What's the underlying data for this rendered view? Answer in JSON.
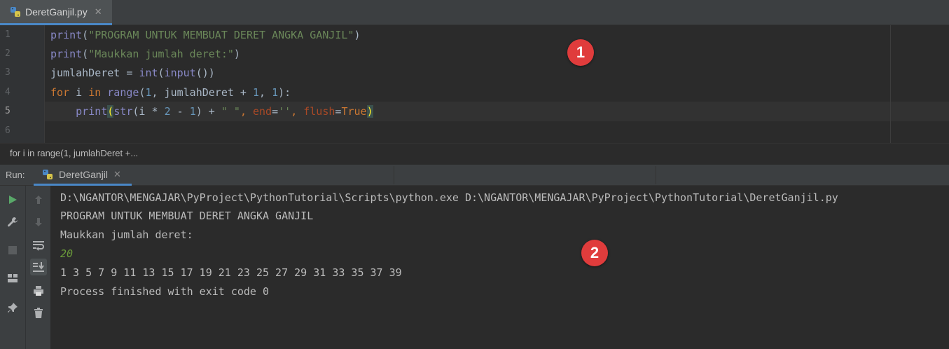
{
  "editor_tab": {
    "label": "DeretGanjil.py",
    "close": "✕"
  },
  "editor": {
    "line_numbers": [
      "1",
      "2",
      "3",
      "4",
      "5",
      "6"
    ],
    "active_line": 5,
    "lines": [
      {
        "tokens": [
          {
            "t": "print",
            "c": "#8888c6"
          },
          {
            "t": "(",
            "c": "#a9b7c6"
          },
          {
            "t": "\"PROGRAM UNTUK MEMBUAT DERET ANGKA GANJIL\"",
            "c": "#6a8759"
          },
          {
            "t": ")",
            "c": "#a9b7c6"
          }
        ]
      },
      {
        "tokens": [
          {
            "t": "print",
            "c": "#8888c6"
          },
          {
            "t": "(",
            "c": "#a9b7c6"
          },
          {
            "t": "\"Maukkan jumlah deret:\"",
            "c": "#6a8759"
          },
          {
            "t": ")",
            "c": "#a9b7c6"
          }
        ]
      },
      {
        "tokens": [
          {
            "t": "jumlahDeret = ",
            "c": "#a9b7c6"
          },
          {
            "t": "int",
            "c": "#8888c6"
          },
          {
            "t": "(",
            "c": "#a9b7c6"
          },
          {
            "t": "input",
            "c": "#8888c6"
          },
          {
            "t": "())",
            "c": "#a9b7c6"
          }
        ]
      },
      {
        "tokens": [
          {
            "t": "for",
            "c": "#cc7832"
          },
          {
            "t": " i ",
            "c": "#a9b7c6"
          },
          {
            "t": "in",
            "c": "#cc7832"
          },
          {
            "t": " ",
            "c": "#a9b7c6"
          },
          {
            "t": "range",
            "c": "#8888c6"
          },
          {
            "t": "(",
            "c": "#a9b7c6"
          },
          {
            "t": "1",
            "c": "#6897bb"
          },
          {
            "t": ", jumlahDeret + ",
            "c": "#a9b7c6"
          },
          {
            "t": "1",
            "c": "#6897bb"
          },
          {
            "t": ", ",
            "c": "#a9b7c6"
          },
          {
            "t": "1",
            "c": "#6897bb"
          },
          {
            "t": "):",
            "c": "#a9b7c6"
          }
        ]
      },
      {
        "tokens": [
          {
            "t": "    ",
            "c": "#a9b7c6"
          },
          {
            "t": "print",
            "c": "#8888c6"
          },
          {
            "t": "(",
            "c": "#ffef28",
            "bg": "#3b514d"
          },
          {
            "t": "str",
            "c": "#8888c6"
          },
          {
            "t": "(i * ",
            "c": "#a9b7c6"
          },
          {
            "t": "2",
            "c": "#6897bb"
          },
          {
            "t": " - ",
            "c": "#a9b7c6"
          },
          {
            "t": "1",
            "c": "#6897bb"
          },
          {
            "t": ") + ",
            "c": "#a9b7c6"
          },
          {
            "t": "\" \"",
            "c": "#6a8759"
          },
          {
            "t": ", ",
            "c": "#cc7832"
          },
          {
            "t": "end",
            "c": "#aa4926"
          },
          {
            "t": "=",
            "c": "#a9b7c6"
          },
          {
            "t": "''",
            "c": "#6a8759"
          },
          {
            "t": ", ",
            "c": "#cc7832"
          },
          {
            "t": "flush",
            "c": "#aa4926"
          },
          {
            "t": "=",
            "c": "#a9b7c6"
          },
          {
            "t": "True",
            "c": "#cc7832"
          },
          {
            "t": ")",
            "c": "#ffef28",
            "bg": "#3b514d"
          }
        ]
      },
      {
        "tokens": []
      }
    ]
  },
  "badges": [
    "1",
    "2"
  ],
  "breadcrumb": "for i in range(1, jumlahDeret +...",
  "run_panel": {
    "label": "Run:",
    "tab_label": "DeretGanjil",
    "close": "✕"
  },
  "console_output": [
    {
      "text": "D:\\NGANTOR\\MENGAJAR\\PyProject\\PythonTutorial\\Scripts\\python.exe D:\\NGANTOR\\MENGAJAR\\PyProject\\PythonTutorial\\DeretGanjil.py",
      "kind": "normal"
    },
    {
      "text": "PROGRAM UNTUK MEMBUAT DERET ANGKA GANJIL",
      "kind": "normal"
    },
    {
      "text": "Maukkan jumlah deret:",
      "kind": "normal"
    },
    {
      "text": "20",
      "kind": "input"
    },
    {
      "text": "1 3 5 7 9 11 13 15 17 19 21 23 25 27 29 31 33 35 37 39",
      "kind": "normal"
    },
    {
      "text": "Process finished with exit code 0",
      "kind": "normal"
    }
  ],
  "toolbar_left": [
    "run-icon",
    "wrench-icon",
    "stop-icon",
    "layout-icon",
    "pin-icon"
  ],
  "toolbar_right": [
    "up-arrow-icon",
    "down-arrow-icon",
    "soft-wrap-icon",
    "scroll-to-end-icon",
    "print-icon",
    "trash-icon"
  ],
  "colors": {
    "accent": "#4a88c7",
    "badge": "#e03c3c",
    "run_green": "#59a869"
  }
}
